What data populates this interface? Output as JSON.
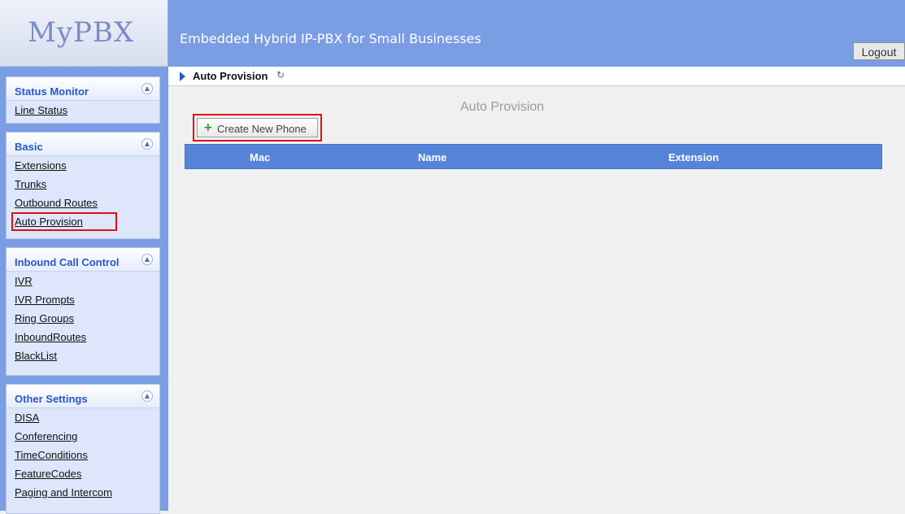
{
  "app": {
    "logo": "MyPBX",
    "header_title": "Embedded Hybrid IP-PBX for Small Businesses",
    "logout_label": "Logout"
  },
  "sidebar": {
    "sections": [
      {
        "title": "Status Monitor",
        "items": [
          "Line Status"
        ]
      },
      {
        "title": "Basic",
        "items": [
          "Extensions",
          "Trunks",
          "Outbound Routes",
          "Auto Provision"
        ]
      },
      {
        "title": "Inbound Call Control",
        "items": [
          "IVR",
          "IVR Prompts",
          "Ring Groups",
          "InboundRoutes",
          "BlackList"
        ]
      },
      {
        "title": "Other Settings",
        "items": [
          "DISA",
          "Conferencing",
          "TimeConditions",
          "FeatureCodes",
          "Paging and Intercom"
        ]
      }
    ],
    "active_item": "Auto Provision"
  },
  "main": {
    "breadcrumb": "Auto Provision",
    "page_title": "Auto Provision",
    "create_button_label": "Create New Phone",
    "table": {
      "columns": [
        "Mac",
        "Name",
        "Extension"
      ],
      "rows": []
    }
  },
  "colors": {
    "header": "#7a9de4",
    "table_header": "#5584d8",
    "highlight": "#e01010"
  }
}
